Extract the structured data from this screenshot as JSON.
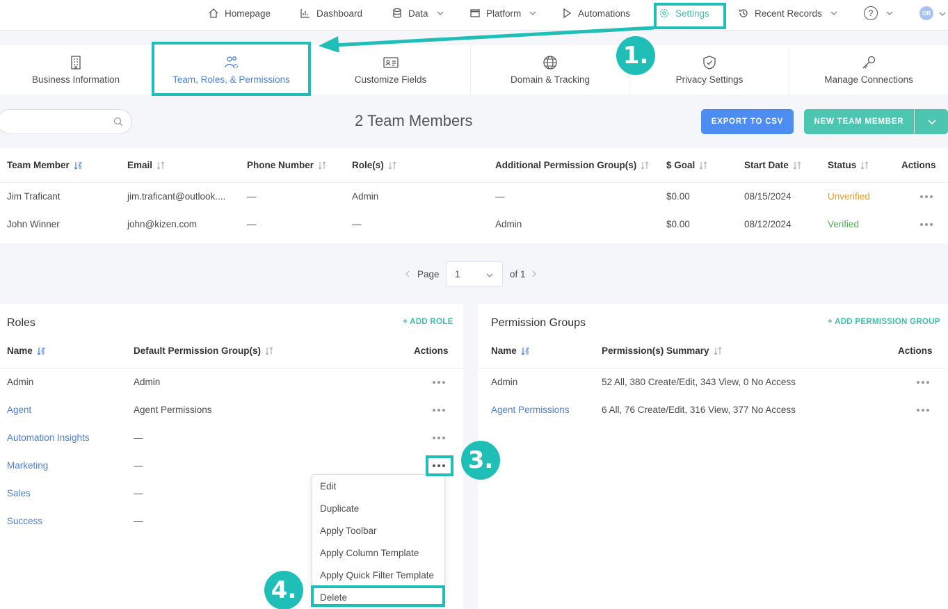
{
  "topnav": {
    "items": [
      {
        "label": "Homepage",
        "icon": "home-icon"
      },
      {
        "label": "Dashboard",
        "icon": "chart-icon"
      },
      {
        "label": "Data",
        "icon": "database-icon"
      },
      {
        "label": "Platform",
        "icon": "window-icon"
      },
      {
        "label": "Automations",
        "icon": "play-icon"
      },
      {
        "label": "Settings",
        "icon": "gear-icon"
      },
      {
        "label": "Recent Records",
        "icon": "history-icon"
      }
    ],
    "help_label": "?",
    "avatar_initials": "OR"
  },
  "tabs": [
    {
      "label": "Business Information",
      "icon": "building-icon"
    },
    {
      "label": "Team, Roles, & Permissions",
      "icon": "team-icon"
    },
    {
      "label": "Customize Fields",
      "icon": "id-card-icon"
    },
    {
      "label": "Domain & Tracking",
      "icon": "globe-icon"
    },
    {
      "label": "Privacy Settings",
      "icon": "shield-icon"
    },
    {
      "label": "Manage Connections",
      "icon": "key-icon"
    }
  ],
  "toolbar": {
    "search_placeholder": "",
    "count_heading": "2 Team Members",
    "export_label": "EXPORT TO CSV",
    "new_member_label": "NEW TEAM MEMBER"
  },
  "team_table": {
    "columns": [
      "Team Member",
      "Email",
      "Phone Number",
      "Role(s)",
      "Additional Permission Group(s)",
      "$ Goal",
      "Start Date",
      "Status",
      "Actions"
    ],
    "rows": [
      {
        "name": "Jim Traficant",
        "email": "jim.traficant@outlook....",
        "phone": "—",
        "role": "Admin",
        "additional": "—",
        "goal": "$0.00",
        "start": "08/15/2024",
        "status": "Unverified"
      },
      {
        "name": "John Winner",
        "email": "john@kizen.com",
        "phone": "—",
        "role": "—",
        "additional": "Admin",
        "goal": "$0.00",
        "start": "08/12/2024",
        "status": "Verified"
      }
    ]
  },
  "pagination": {
    "page_label": "Page",
    "current": "1",
    "of_label": "of 1"
  },
  "roles": {
    "title": "Roles",
    "add_label": "+ ADD ROLE",
    "columns": [
      "Name",
      "Default Permission Group(s)",
      "Actions"
    ],
    "rows": [
      {
        "name": "Admin",
        "group": "Admin"
      },
      {
        "name": "Agent",
        "group": "Agent Permissions"
      },
      {
        "name": "Automation Insights",
        "group": "—"
      },
      {
        "name": "Marketing",
        "group": "—"
      },
      {
        "name": "Sales",
        "group": "—"
      },
      {
        "name": "Success",
        "group": "—"
      }
    ]
  },
  "permission_groups": {
    "title": "Permission Groups",
    "add_label": "+ ADD PERMISSION GROUP",
    "columns": [
      "Name",
      "Permission(s) Summary",
      "Actions"
    ],
    "rows": [
      {
        "name": "Admin",
        "summary": "52 All, 380 Create/Edit, 343 View, 0 No Access"
      },
      {
        "name": "Agent Permissions",
        "summary": "6 All, 76 Create/Edit, 316 View, 377 No Access"
      }
    ]
  },
  "menu": {
    "items": [
      "Edit",
      "Duplicate",
      "Apply Toolbar",
      "Apply Column Template",
      "Apply Quick Filter Template",
      "Delete"
    ]
  },
  "annotations": {
    "step1": "1.",
    "step3": "3.",
    "step4": "4."
  },
  "colors": {
    "accent": "#1fbfb8",
    "link": "#4a7fd9",
    "export": "#4d8cf0",
    "new": "#4cc6b0",
    "unverified": "#e6a023",
    "verified": "#4cb050"
  }
}
